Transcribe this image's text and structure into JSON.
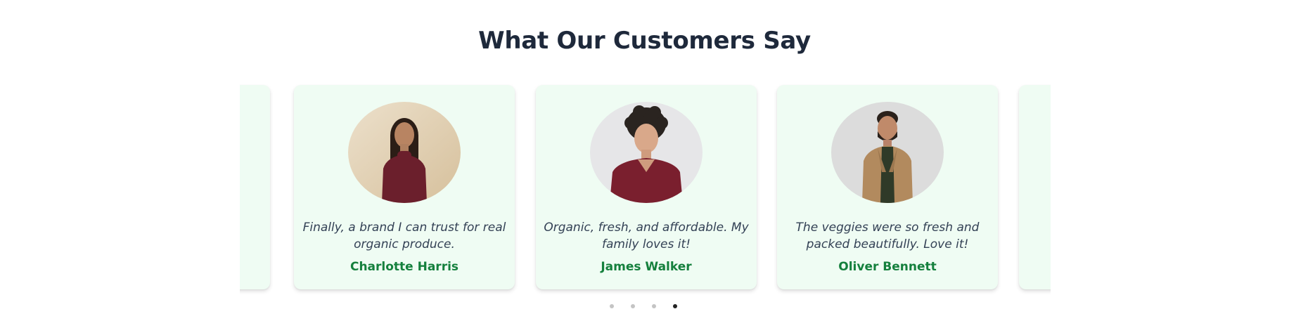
{
  "section": {
    "title": "What Our Customers Say"
  },
  "testimonials": [
    {
      "quote": "Finally, a brand I can trust for real organic produce.",
      "name": "Charlotte Harris",
      "avatar": "woman-portrait-avatar"
    },
    {
      "quote": "Organic, fresh, and affordable. My family loves it!",
      "name": "James Walker",
      "avatar": "man-portrait-avatar"
    },
    {
      "quote": "The veggies were so fresh and packed beautifully. Love it!",
      "name": "Oliver Bennett",
      "avatar": "man-blazer-portrait-avatar"
    }
  ],
  "carousel": {
    "dot_count": 4,
    "active_dot": 4
  },
  "colors": {
    "card_background": "#effcf3",
    "name_green": "#15803d",
    "title_dark": "#1e293b",
    "dot_active": "#222222",
    "dot_inactive": "#c4c4c4"
  }
}
